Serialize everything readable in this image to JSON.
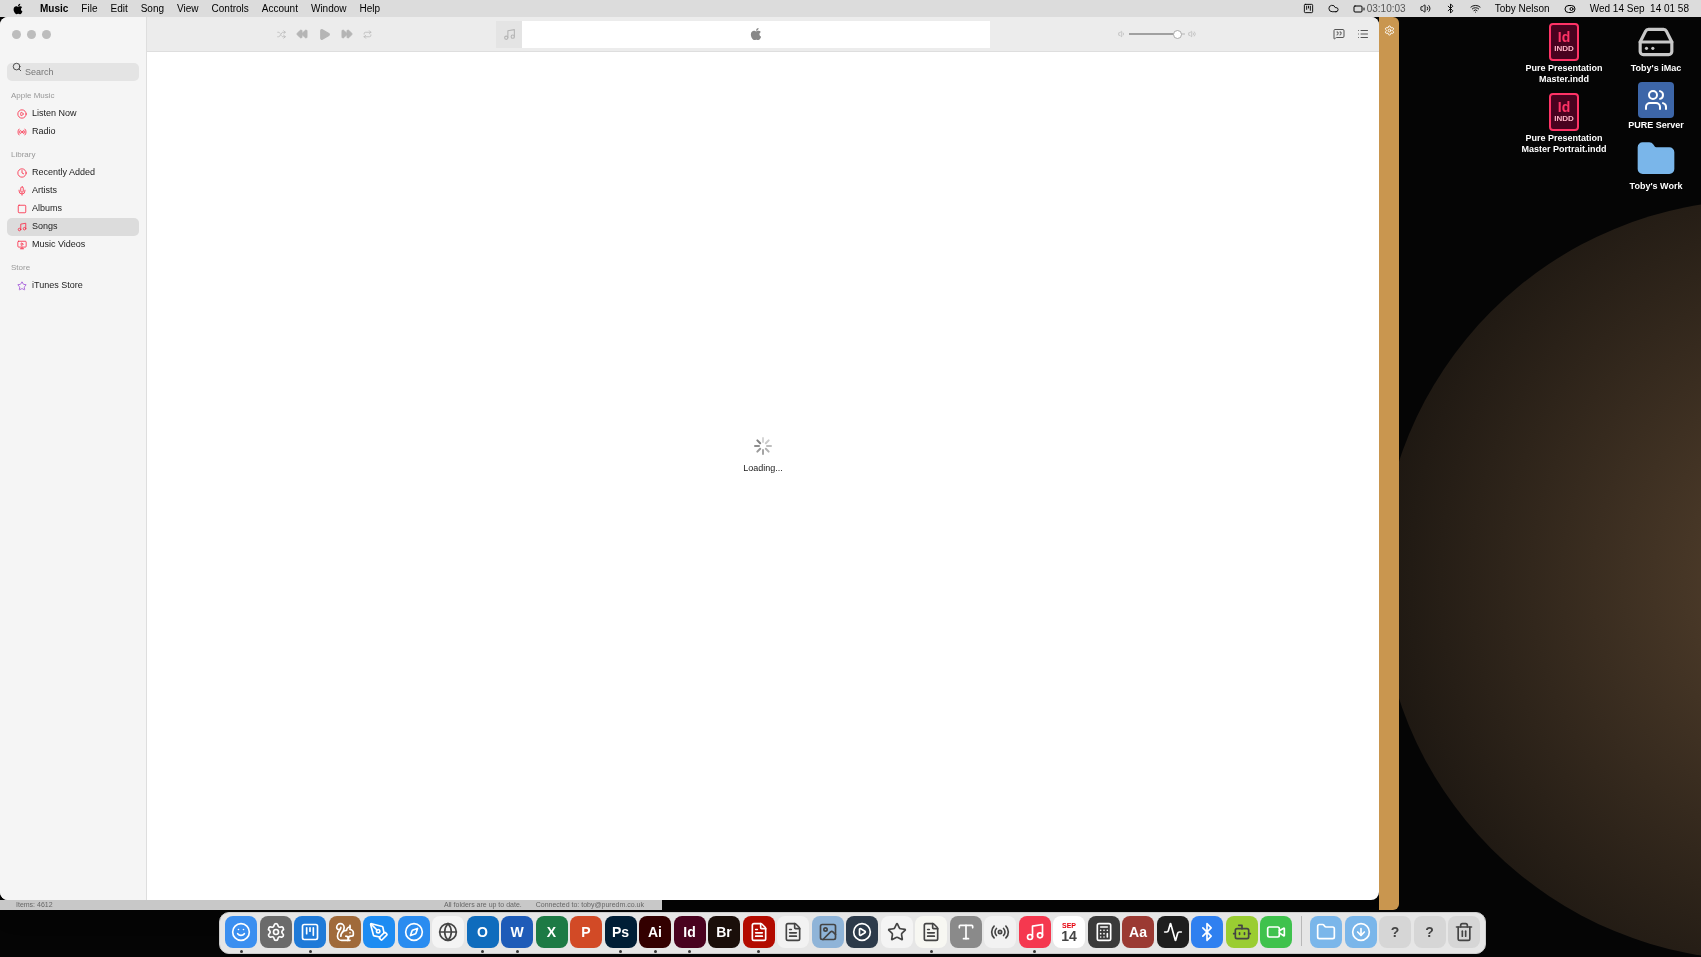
{
  "menu_bar": {
    "app_name": "Music",
    "menus": [
      "File",
      "Edit",
      "Song",
      "View",
      "Controls",
      "Account",
      "Window",
      "Help"
    ],
    "battery_time": "03:10:03",
    "user": "Toby Nelson",
    "clock": "Wed 14 Sep  14 01 58"
  },
  "player": {
    "volume": {
      "level": 0.85
    }
  },
  "sidebar": {
    "search": {
      "placeholder": "Search"
    },
    "sections": [
      {
        "title": "Apple Music",
        "items": [
          {
            "label": "Listen Now",
            "selected": false
          },
          {
            "label": "Radio",
            "selected": false
          }
        ]
      },
      {
        "title": "Library",
        "items": [
          {
            "label": "Recently Added",
            "selected": false
          },
          {
            "label": "Artists",
            "selected": false
          },
          {
            "label": "Albums",
            "selected": false
          },
          {
            "label": "Songs",
            "selected": true
          },
          {
            "label": "Music Videos",
            "selected": false
          }
        ]
      },
      {
        "title": "Store",
        "items": [
          {
            "label": "iTunes Store",
            "selected": false
          }
        ]
      }
    ]
  },
  "content": {
    "status": "Loading..."
  },
  "back_window": {
    "items": "Items: 4612",
    "sync": "All folders are up to date.",
    "connection": "Connected to: toby@puredm.co.uk"
  },
  "desktop_icons": [
    {
      "label": "Pure Presentation Master.indd",
      "kind": "indd",
      "badge": "Id",
      "type": "INDD"
    },
    {
      "label": "Toby's iMac",
      "kind": "drive"
    },
    {
      "label": "Pure Presentation Master Portrait.indd",
      "kind": "indd",
      "badge": "Id",
      "type": "INDD"
    },
    {
      "label": "PURE Server",
      "kind": "server"
    },
    {
      "label": "Toby's Work",
      "kind": "folder"
    }
  ],
  "dock": {
    "apps": [
      {
        "color": "#3b8ff0",
        "running": true
      },
      {
        "color": "#6b6b6b",
        "running": false
      },
      {
        "color": "#1f7ad8",
        "running": true
      },
      {
        "color": "#a06a3a",
        "running": false
      },
      {
        "color": "#1d8cf2",
        "running": false
      },
      {
        "color": "#2a8cf0",
        "running": false
      },
      {
        "color": "#f4f4f4",
        "running": false
      },
      {
        "label": "O",
        "color": "#0f6cbd",
        "running": true
      },
      {
        "label": "W",
        "color": "#1e5bb8",
        "running": true
      },
      {
        "label": "X",
        "color": "#1d7a45",
        "running": false
      },
      {
        "label": "P",
        "color": "#d24a26",
        "running": false
      },
      {
        "label": "Ps",
        "color": "#001e36",
        "running": true
      },
      {
        "label": "Ai",
        "color": "#330000",
        "running": true
      },
      {
        "label": "Id",
        "color": "#49021f",
        "running": true
      },
      {
        "label": "Br",
        "color": "#1a0f0a",
        "running": false
      },
      {
        "color": "#b30b00",
        "running": true
      },
      {
        "color": "#f2f2f2",
        "running": false
      },
      {
        "color": "#8fb4d8",
        "running": false
      },
      {
        "color": "#2c3a4a",
        "running": false
      },
      {
        "color": "#f4f4f4",
        "running": false
      },
      {
        "color": "#f7f7f2",
        "running": true
      },
      {
        "color": "#8a8a8a",
        "running": false
      },
      {
        "color": "#f2f2f2",
        "running": false
      },
      {
        "color": "#f5384f",
        "running": true
      },
      {
        "top_label": "SEP",
        "label": "14",
        "color": "#ffffff",
        "running": false
      },
      {
        "color": "#3a3a3a",
        "running": false
      },
      {
        "label": "Aa",
        "color": "#9b3a33",
        "running": false
      },
      {
        "color": "#1e1e1e",
        "running": false
      },
      {
        "color": "#2f80f0",
        "running": false
      },
      {
        "color": "#9acd32",
        "running": false
      },
      {
        "color": "#3fc24d",
        "running": false
      }
    ],
    "folders": [
      {
        "color": "#7ab6ea"
      },
      {
        "color": "#7ab6ea"
      },
      {
        "label": "?",
        "color": "#d6d6d6"
      },
      {
        "label": "?",
        "color": "#d6d6d6"
      },
      {
        "color": "#d6d6d6"
      }
    ]
  }
}
